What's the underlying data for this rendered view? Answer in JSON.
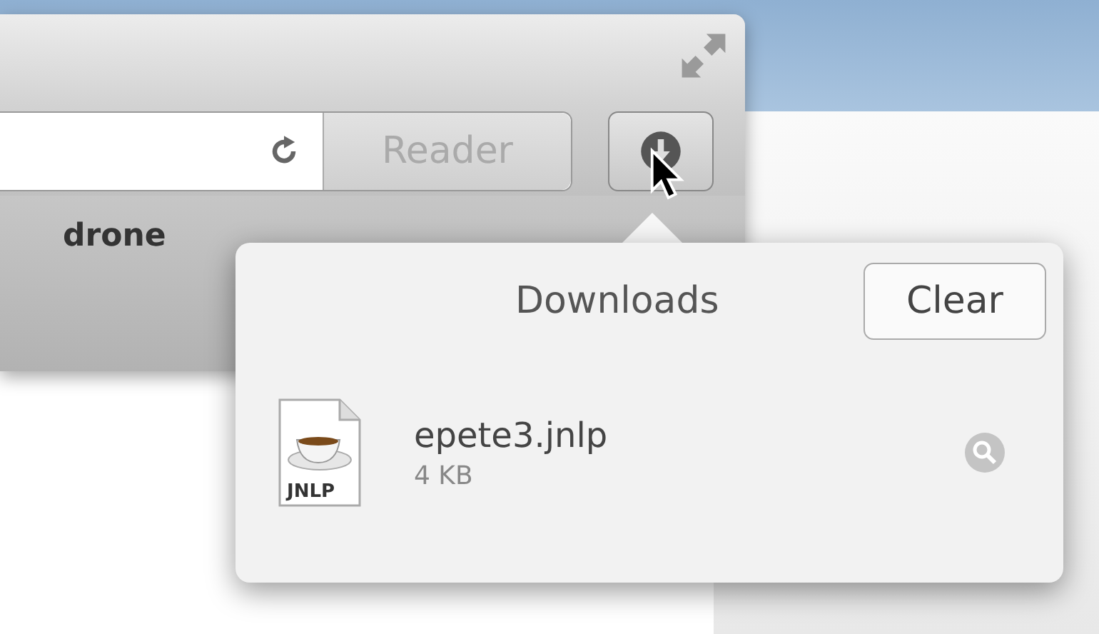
{
  "toolbar": {
    "reader_button": "Reader"
  },
  "bookmarks": [
    "drone"
  ],
  "downloads_popover": {
    "title": "Downloads",
    "clear_button": "Clear",
    "items": [
      {
        "name": "epete3.jnlp",
        "size": "4 KB",
        "badge": "JNLP"
      }
    ]
  }
}
